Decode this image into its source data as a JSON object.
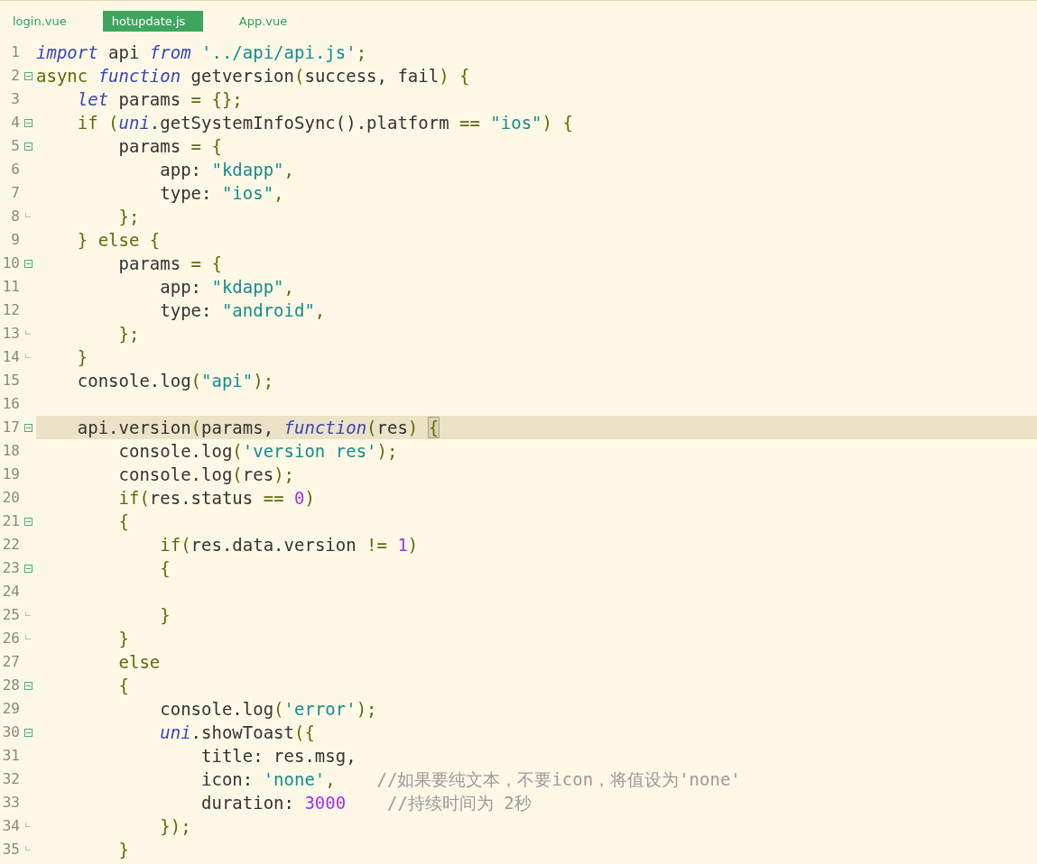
{
  "tabs": [
    {
      "label": "login.vue",
      "selected": false
    },
    {
      "label": "hotupdate.js",
      "selected": true
    },
    {
      "label": "App.vue",
      "selected": false
    }
  ],
  "lines": [
    {
      "number": "1",
      "foldable": false,
      "fold_end": false,
      "current": false,
      "tokens": [
        {
          "kind": "keyword",
          "text": "import"
        },
        {
          "kind": "ident",
          "text": " api "
        },
        {
          "kind": "keyword",
          "text": "from"
        },
        {
          "kind": "string",
          "text": " '../api/api.js'"
        },
        {
          "kind": "punct",
          "text": ";"
        }
      ]
    },
    {
      "number": "2",
      "foldable": true,
      "fold_end": false,
      "current": false,
      "tokens": [
        {
          "kind": "control",
          "text": "async "
        },
        {
          "kind": "keyword",
          "text": "function"
        },
        {
          "kind": "ident",
          "text": " getversion"
        },
        {
          "kind": "punct",
          "text": "("
        },
        {
          "kind": "ident",
          "text": "success, fail"
        },
        {
          "kind": "punct",
          "text": ") {"
        }
      ]
    },
    {
      "number": "3",
      "foldable": false,
      "fold_end": false,
      "current": false,
      "tokens": [
        {
          "kind": "keyword",
          "text": "    let"
        },
        {
          "kind": "ident",
          "text": " params "
        },
        {
          "kind": "punct",
          "text": "= {};"
        }
      ]
    },
    {
      "number": "4",
      "foldable": true,
      "fold_end": false,
      "current": false,
      "tokens": [
        {
          "kind": "control",
          "text": "    if "
        },
        {
          "kind": "punct",
          "text": "("
        },
        {
          "kind": "keyword",
          "text": "uni"
        },
        {
          "kind": "ident",
          "text": ".getSystemInfoSync().platform "
        },
        {
          "kind": "punct",
          "text": "== "
        },
        {
          "kind": "string",
          "text": "\"ios\""
        },
        {
          "kind": "punct",
          "text": ") {"
        }
      ]
    },
    {
      "number": "5",
      "foldable": true,
      "fold_end": false,
      "current": false,
      "tokens": [
        {
          "kind": "ident",
          "text": "        params "
        },
        {
          "kind": "punct",
          "text": "= {"
        }
      ]
    },
    {
      "number": "6",
      "foldable": false,
      "fold_end": false,
      "current": false,
      "tokens": [
        {
          "kind": "ident",
          "text": "            app: "
        },
        {
          "kind": "string",
          "text": "\"kdapp\""
        },
        {
          "kind": "punct",
          "text": ","
        }
      ]
    },
    {
      "number": "7",
      "foldable": false,
      "fold_end": false,
      "current": false,
      "tokens": [
        {
          "kind": "ident",
          "text": "            type: "
        },
        {
          "kind": "string",
          "text": "\"ios\""
        },
        {
          "kind": "punct",
          "text": ","
        }
      ]
    },
    {
      "number": "8",
      "foldable": false,
      "fold_end": true,
      "current": false,
      "tokens": [
        {
          "kind": "punct",
          "text": "        };"
        }
      ]
    },
    {
      "number": "9",
      "foldable": false,
      "fold_end": false,
      "current": false,
      "tokens": [
        {
          "kind": "punct",
          "text": "    } "
        },
        {
          "kind": "control",
          "text": "else "
        },
        {
          "kind": "punct",
          "text": "{"
        }
      ]
    },
    {
      "number": "10",
      "foldable": true,
      "fold_end": false,
      "current": false,
      "tokens": [
        {
          "kind": "ident",
          "text": "        params "
        },
        {
          "kind": "punct",
          "text": "= {"
        }
      ]
    },
    {
      "number": "11",
      "foldable": false,
      "fold_end": false,
      "current": false,
      "tokens": [
        {
          "kind": "ident",
          "text": "            app: "
        },
        {
          "kind": "string",
          "text": "\"kdapp\""
        },
        {
          "kind": "punct",
          "text": ","
        }
      ]
    },
    {
      "number": "12",
      "foldable": false,
      "fold_end": false,
      "current": false,
      "tokens": [
        {
          "kind": "ident",
          "text": "            type: "
        },
        {
          "kind": "string",
          "text": "\"android\""
        },
        {
          "kind": "punct",
          "text": ","
        }
      ]
    },
    {
      "number": "13",
      "foldable": false,
      "fold_end": true,
      "current": false,
      "tokens": [
        {
          "kind": "punct",
          "text": "        };"
        }
      ]
    },
    {
      "number": "14",
      "foldable": false,
      "fold_end": true,
      "current": false,
      "tokens": [
        {
          "kind": "punct",
          "text": "    }"
        }
      ]
    },
    {
      "number": "15",
      "foldable": false,
      "fold_end": false,
      "current": false,
      "tokens": [
        {
          "kind": "ident",
          "text": "    console.log"
        },
        {
          "kind": "punct",
          "text": "("
        },
        {
          "kind": "string",
          "text": "\"api\""
        },
        {
          "kind": "punct",
          "text": ");"
        }
      ]
    },
    {
      "number": "16",
      "foldable": false,
      "fold_end": false,
      "current": false
    },
    {
      "number": "17",
      "foldable": true,
      "fold_end": false,
      "current": true,
      "tokens": [
        {
          "kind": "ident",
          "text": "    api.version"
        },
        {
          "kind": "punct",
          "text": "("
        },
        {
          "kind": "ident",
          "text": "params, "
        },
        {
          "kind": "keyword",
          "text": "function"
        },
        {
          "kind": "punct",
          "text": "("
        },
        {
          "kind": "ident",
          "text": "res"
        },
        {
          "kind": "punct",
          "text": ") "
        },
        {
          "kind": "bracket",
          "text": "{"
        }
      ]
    },
    {
      "number": "18",
      "foldable": false,
      "fold_end": false,
      "current": false,
      "tokens": [
        {
          "kind": "ident",
          "text": "        console.log"
        },
        {
          "kind": "punct",
          "text": "("
        },
        {
          "kind": "string",
          "text": "'version res'"
        },
        {
          "kind": "punct",
          "text": ");"
        }
      ]
    },
    {
      "number": "19",
      "foldable": false,
      "fold_end": false,
      "current": false,
      "tokens": [
        {
          "kind": "ident",
          "text": "        console.log"
        },
        {
          "kind": "punct",
          "text": "("
        },
        {
          "kind": "ident",
          "text": "res"
        },
        {
          "kind": "punct",
          "text": ");"
        }
      ]
    },
    {
      "number": "20",
      "foldable": false,
      "fold_end": false,
      "current": false,
      "tokens": [
        {
          "kind": "control",
          "text": "        if"
        },
        {
          "kind": "punct",
          "text": "("
        },
        {
          "kind": "ident",
          "text": "res.status "
        },
        {
          "kind": "punct",
          "text": "== "
        },
        {
          "kind": "number",
          "text": "0"
        },
        {
          "kind": "punct",
          "text": ")"
        }
      ]
    },
    {
      "number": "21",
      "foldable": true,
      "fold_end": false,
      "current": false,
      "tokens": [
        {
          "kind": "punct",
          "text": "        {"
        }
      ]
    },
    {
      "number": "22",
      "foldable": false,
      "fold_end": false,
      "current": false,
      "tokens": [
        {
          "kind": "control",
          "text": "            if"
        },
        {
          "kind": "punct",
          "text": "("
        },
        {
          "kind": "ident",
          "text": "res.data.version "
        },
        {
          "kind": "punct",
          "text": "!= "
        },
        {
          "kind": "number",
          "text": "1"
        },
        {
          "kind": "punct",
          "text": ")"
        }
      ]
    },
    {
      "number": "23",
      "foldable": true,
      "fold_end": false,
      "current": false,
      "tokens": [
        {
          "kind": "punct",
          "text": "            {"
        }
      ]
    },
    {
      "number": "24",
      "foldable": false,
      "fold_end": false,
      "current": false
    },
    {
      "number": "25",
      "foldable": false,
      "fold_end": true,
      "current": false,
      "tokens": [
        {
          "kind": "punct",
          "text": "            }"
        }
      ]
    },
    {
      "number": "26",
      "foldable": false,
      "fold_end": true,
      "current": false,
      "tokens": [
        {
          "kind": "punct",
          "text": "        }"
        }
      ]
    },
    {
      "number": "27",
      "foldable": false,
      "fold_end": false,
      "current": false,
      "tokens": [
        {
          "kind": "control",
          "text": "        else"
        }
      ]
    },
    {
      "number": "28",
      "foldable": true,
      "fold_end": false,
      "current": false,
      "tokens": [
        {
          "kind": "punct",
          "text": "        {"
        }
      ]
    },
    {
      "number": "29",
      "foldable": false,
      "fold_end": false,
      "current": false,
      "tokens": [
        {
          "kind": "ident",
          "text": "            console.log"
        },
        {
          "kind": "punct",
          "text": "("
        },
        {
          "kind": "string",
          "text": "'error'"
        },
        {
          "kind": "punct",
          "text": ");"
        }
      ]
    },
    {
      "number": "30",
      "foldable": true,
      "fold_end": false,
      "current": false,
      "tokens": [
        {
          "kind": "keyword",
          "text": "            uni"
        },
        {
          "kind": "ident",
          "text": ".showToast"
        },
        {
          "kind": "punct",
          "text": "({"
        }
      ]
    },
    {
      "number": "31",
      "foldable": false,
      "fold_end": false,
      "current": false,
      "tokens": [
        {
          "kind": "ident",
          "text": "                title: res.msg,"
        }
      ]
    },
    {
      "number": "32",
      "foldable": false,
      "fold_end": false,
      "current": false,
      "tokens": [
        {
          "kind": "ident",
          "text": "                icon: "
        },
        {
          "kind": "string",
          "text": "'none'"
        },
        {
          "kind": "punct",
          "text": ","
        },
        {
          "kind": "comment",
          "text": "    //如果要纯文本，不要icon，将值设为'none'"
        }
      ]
    },
    {
      "number": "33",
      "foldable": false,
      "fold_end": false,
      "current": false,
      "tokens": [
        {
          "kind": "ident",
          "text": "                duration: "
        },
        {
          "kind": "number",
          "text": "3000"
        },
        {
          "kind": "comment",
          "text": "    //持续时间为 2秒"
        }
      ]
    },
    {
      "number": "34",
      "foldable": false,
      "fold_end": true,
      "current": false,
      "tokens": [
        {
          "kind": "punct",
          "text": "            });"
        }
      ]
    },
    {
      "number": "35",
      "foldable": false,
      "fold_end": true,
      "current": false,
      "tokens": [
        {
          "kind": "punct",
          "text": "        }"
        }
      ]
    }
  ]
}
